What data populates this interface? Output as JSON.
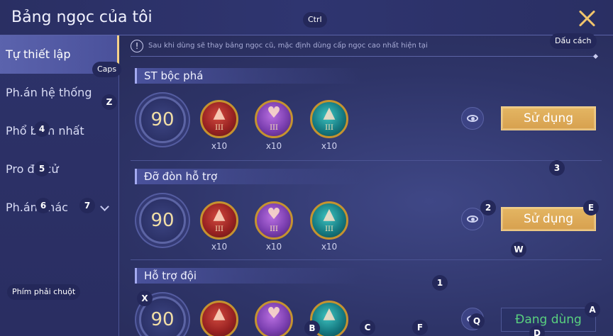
{
  "header": {
    "title": "Bảng ngọc của tôi"
  },
  "sidebar": {
    "items": [
      {
        "label": "Tự thiết lập"
      },
      {
        "label": "Ph.án hệ thống"
      },
      {
        "label": "Phổ biến nhất"
      },
      {
        "label": "Pro đề cử"
      },
      {
        "label": "Ph.án khác"
      }
    ]
  },
  "notice": {
    "icon": "!",
    "text": "Sau khi dùng sẽ thay bảng ngọc cũ, mặc định dùng cấp ngọc cao nhất hiện tại"
  },
  "sections": [
    {
      "title": "ST bộc phá",
      "level": "90",
      "gems": [
        {
          "color": "red",
          "tier": "III",
          "count": "x10"
        },
        {
          "color": "purple",
          "tier": "III",
          "count": "x10"
        },
        {
          "color": "teal",
          "tier": "III",
          "count": "x10"
        }
      ],
      "button": "Sử dụng"
    },
    {
      "title": "Đỡ đòn hỗ trợ",
      "level": "90",
      "gems": [
        {
          "color": "red",
          "tier": "III",
          "count": "x10"
        },
        {
          "color": "purple",
          "tier": "III",
          "count": "x10"
        },
        {
          "color": "teal",
          "tier": "III",
          "count": "x10"
        }
      ],
      "button": "Sử dụng"
    },
    {
      "title": "Hỗ trợ đội",
      "level": "90",
      "gems": [
        {
          "color": "red",
          "tier": "",
          "count": ""
        },
        {
          "color": "purple",
          "tier": "",
          "count": ""
        },
        {
          "color": "teal",
          "tier": "",
          "count": ""
        }
      ],
      "button": "Đang dùng"
    }
  ],
  "key_hints": {
    "ctrl": "Ctrl",
    "space": "Dấu cách",
    "caps": "Caps",
    "right_click": "Phím phải chuột",
    "z": "Z",
    "k4": "4",
    "k5": "5",
    "k6": "6",
    "k7": "7",
    "k3": "3",
    "k2": "2",
    "e": "E",
    "w": "W",
    "k1": "1",
    "x": "X",
    "a": "A",
    "q": "Q",
    "b": "B",
    "c": "C",
    "f": "F",
    "d": "D"
  },
  "colors": {
    "accent_gold": "#d7a04e",
    "in_use_green": "#59d17f",
    "background": "#2e3468"
  }
}
